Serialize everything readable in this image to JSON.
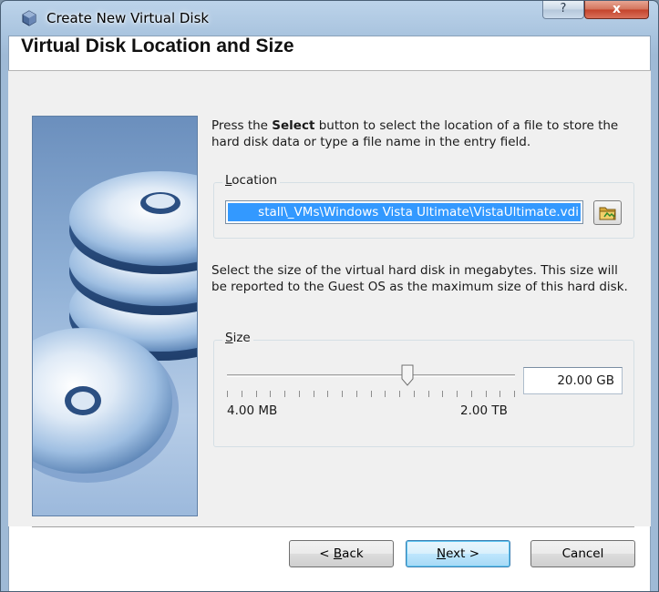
{
  "window": {
    "title": "Create New Virtual Disk",
    "help_glyph": "?",
    "close_glyph": "x"
  },
  "page": {
    "header": "Virtual Disk Location and Size",
    "intro_pre": "Press the ",
    "intro_bold": "Select",
    "intro_post": " button to select the location of a file to store the hard disk data or type a file name in the entry field."
  },
  "location": {
    "label_accel": "L",
    "label_rest": "ocation",
    "value": "stall\\_VMs\\Windows Vista Ultimate\\VistaUltimate.vdi",
    "browse_icon": "folder-icon"
  },
  "size": {
    "description": "Select the size of the virtual hard disk in megabytes. This size will be reported to the Guest OS as the maximum size of this hard disk.",
    "label_accel": "S",
    "label_rest": "ize",
    "value": "20.00 GB",
    "min_label": "4.00 MB",
    "max_label": "2.00 TB",
    "slider_position_fraction": 0.625
  },
  "buttons": {
    "back_pre": "< ",
    "back_accel": "B",
    "back_rest": "ack",
    "next_accel": "N",
    "next_rest": "ext >",
    "cancel": "Cancel"
  }
}
